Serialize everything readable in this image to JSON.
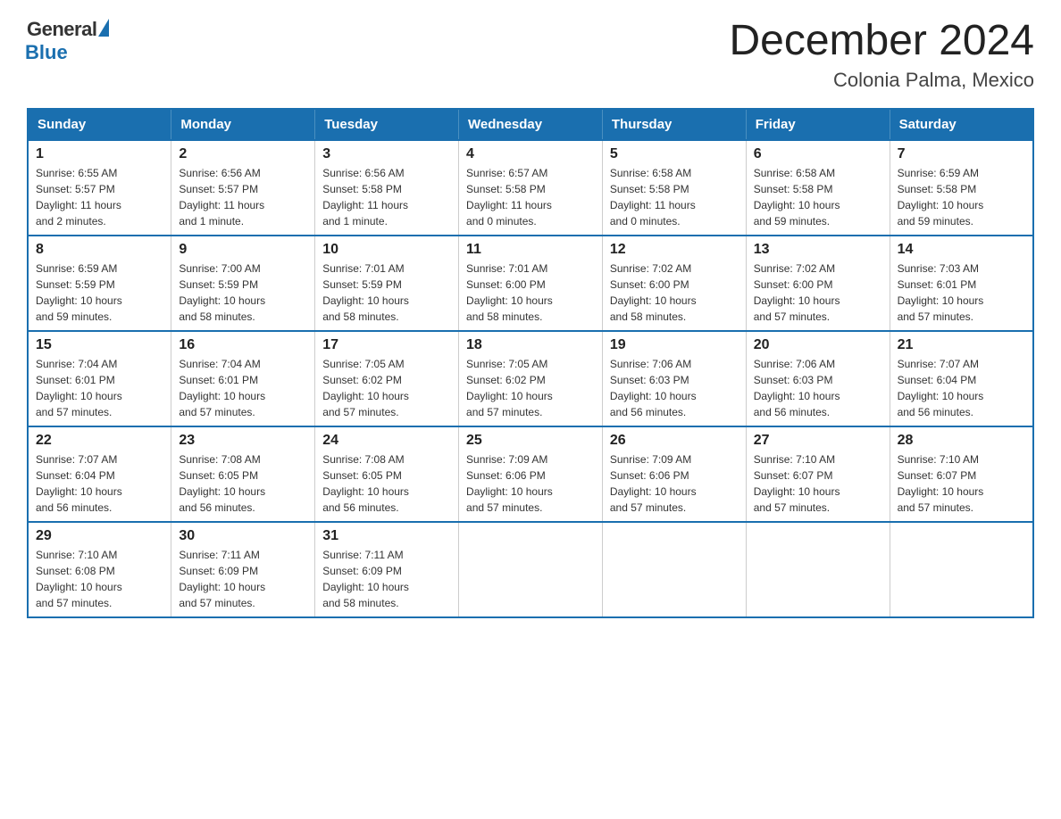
{
  "logo": {
    "general": "General",
    "blue": "Blue"
  },
  "title": "December 2024",
  "location": "Colonia Palma, Mexico",
  "days_of_week": [
    "Sunday",
    "Monday",
    "Tuesday",
    "Wednesday",
    "Thursday",
    "Friday",
    "Saturday"
  ],
  "weeks": [
    [
      {
        "day": "1",
        "sunrise": "6:55 AM",
        "sunset": "5:57 PM",
        "daylight": "11 hours and 2 minutes."
      },
      {
        "day": "2",
        "sunrise": "6:56 AM",
        "sunset": "5:57 PM",
        "daylight": "11 hours and 1 minute."
      },
      {
        "day": "3",
        "sunrise": "6:56 AM",
        "sunset": "5:58 PM",
        "daylight": "11 hours and 1 minute."
      },
      {
        "day": "4",
        "sunrise": "6:57 AM",
        "sunset": "5:58 PM",
        "daylight": "11 hours and 0 minutes."
      },
      {
        "day": "5",
        "sunrise": "6:58 AM",
        "sunset": "5:58 PM",
        "daylight": "11 hours and 0 minutes."
      },
      {
        "day": "6",
        "sunrise": "6:58 AM",
        "sunset": "5:58 PM",
        "daylight": "10 hours and 59 minutes."
      },
      {
        "day": "7",
        "sunrise": "6:59 AM",
        "sunset": "5:58 PM",
        "daylight": "10 hours and 59 minutes."
      }
    ],
    [
      {
        "day": "8",
        "sunrise": "6:59 AM",
        "sunset": "5:59 PM",
        "daylight": "10 hours and 59 minutes."
      },
      {
        "day": "9",
        "sunrise": "7:00 AM",
        "sunset": "5:59 PM",
        "daylight": "10 hours and 58 minutes."
      },
      {
        "day": "10",
        "sunrise": "7:01 AM",
        "sunset": "5:59 PM",
        "daylight": "10 hours and 58 minutes."
      },
      {
        "day": "11",
        "sunrise": "7:01 AM",
        "sunset": "6:00 PM",
        "daylight": "10 hours and 58 minutes."
      },
      {
        "day": "12",
        "sunrise": "7:02 AM",
        "sunset": "6:00 PM",
        "daylight": "10 hours and 58 minutes."
      },
      {
        "day": "13",
        "sunrise": "7:02 AM",
        "sunset": "6:00 PM",
        "daylight": "10 hours and 57 minutes."
      },
      {
        "day": "14",
        "sunrise": "7:03 AM",
        "sunset": "6:01 PM",
        "daylight": "10 hours and 57 minutes."
      }
    ],
    [
      {
        "day": "15",
        "sunrise": "7:04 AM",
        "sunset": "6:01 PM",
        "daylight": "10 hours and 57 minutes."
      },
      {
        "day": "16",
        "sunrise": "7:04 AM",
        "sunset": "6:01 PM",
        "daylight": "10 hours and 57 minutes."
      },
      {
        "day": "17",
        "sunrise": "7:05 AM",
        "sunset": "6:02 PM",
        "daylight": "10 hours and 57 minutes."
      },
      {
        "day": "18",
        "sunrise": "7:05 AM",
        "sunset": "6:02 PM",
        "daylight": "10 hours and 57 minutes."
      },
      {
        "day": "19",
        "sunrise": "7:06 AM",
        "sunset": "6:03 PM",
        "daylight": "10 hours and 56 minutes."
      },
      {
        "day": "20",
        "sunrise": "7:06 AM",
        "sunset": "6:03 PM",
        "daylight": "10 hours and 56 minutes."
      },
      {
        "day": "21",
        "sunrise": "7:07 AM",
        "sunset": "6:04 PM",
        "daylight": "10 hours and 56 minutes."
      }
    ],
    [
      {
        "day": "22",
        "sunrise": "7:07 AM",
        "sunset": "6:04 PM",
        "daylight": "10 hours and 56 minutes."
      },
      {
        "day": "23",
        "sunrise": "7:08 AM",
        "sunset": "6:05 PM",
        "daylight": "10 hours and 56 minutes."
      },
      {
        "day": "24",
        "sunrise": "7:08 AM",
        "sunset": "6:05 PM",
        "daylight": "10 hours and 56 minutes."
      },
      {
        "day": "25",
        "sunrise": "7:09 AM",
        "sunset": "6:06 PM",
        "daylight": "10 hours and 57 minutes."
      },
      {
        "day": "26",
        "sunrise": "7:09 AM",
        "sunset": "6:06 PM",
        "daylight": "10 hours and 57 minutes."
      },
      {
        "day": "27",
        "sunrise": "7:10 AM",
        "sunset": "6:07 PM",
        "daylight": "10 hours and 57 minutes."
      },
      {
        "day": "28",
        "sunrise": "7:10 AM",
        "sunset": "6:07 PM",
        "daylight": "10 hours and 57 minutes."
      }
    ],
    [
      {
        "day": "29",
        "sunrise": "7:10 AM",
        "sunset": "6:08 PM",
        "daylight": "10 hours and 57 minutes."
      },
      {
        "day": "30",
        "sunrise": "7:11 AM",
        "sunset": "6:09 PM",
        "daylight": "10 hours and 57 minutes."
      },
      {
        "day": "31",
        "sunrise": "7:11 AM",
        "sunset": "6:09 PM",
        "daylight": "10 hours and 58 minutes."
      },
      null,
      null,
      null,
      null
    ]
  ],
  "labels": {
    "sunrise": "Sunrise:",
    "sunset": "Sunset:",
    "daylight": "Daylight:"
  }
}
